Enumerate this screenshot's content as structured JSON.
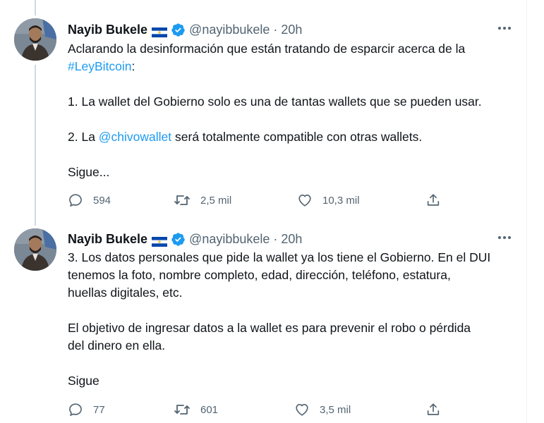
{
  "tweets": [
    {
      "author": {
        "name": "Nayib Bukele",
        "handle": "@nayibbukele",
        "time": "· 20h"
      },
      "text": {
        "l1": "Aclarando la desinformación que están tratando de esparcir acerca de la",
        "hashtag": "#LeyBitcoin",
        "hashtag_suffix": ":",
        "p2": "1. La wallet del Gobierno solo es una de tantas wallets que se pueden usar.",
        "p3_pre": "2. La ",
        "mention": "@chivowallet",
        "p3_post": " será totalmente compatible con otras wallets.",
        "p4": "Sigue..."
      },
      "actions": {
        "replies": "594",
        "retweets": "2,5 mil",
        "likes": "10,3 mil"
      }
    },
    {
      "author": {
        "name": "Nayib Bukele",
        "handle": "@nayibbukele",
        "time": "· 20h"
      },
      "text": {
        "l1": "3. Los datos personales que pide la wallet ya los tiene el Gobierno. En el DUI",
        "l2": "tenemos la foto, nombre completo, edad, dirección, teléfono, estatura,",
        "l3": "huellas digitales, etc.",
        "p2_l1": "El objetivo de ingresar datos a la wallet es para prevenir el robo o pérdida",
        "p2_l2": "del dinero en ella.",
        "p3": "Sigue"
      },
      "actions": {
        "replies": "77",
        "retweets": "601",
        "likes": "3,5 mil"
      }
    }
  ],
  "icons": {
    "reply": "reply-icon",
    "retweet": "retweet-icon",
    "like": "heart-icon",
    "share": "share-icon",
    "more": "more-icon",
    "verified": "verified-badge-icon",
    "flag": "el-salvador-flag-icon"
  },
  "colors": {
    "link": "#1d9bf0",
    "text": "#0f1419",
    "secondary": "#536471",
    "thread_line": "#cfd9de"
  }
}
